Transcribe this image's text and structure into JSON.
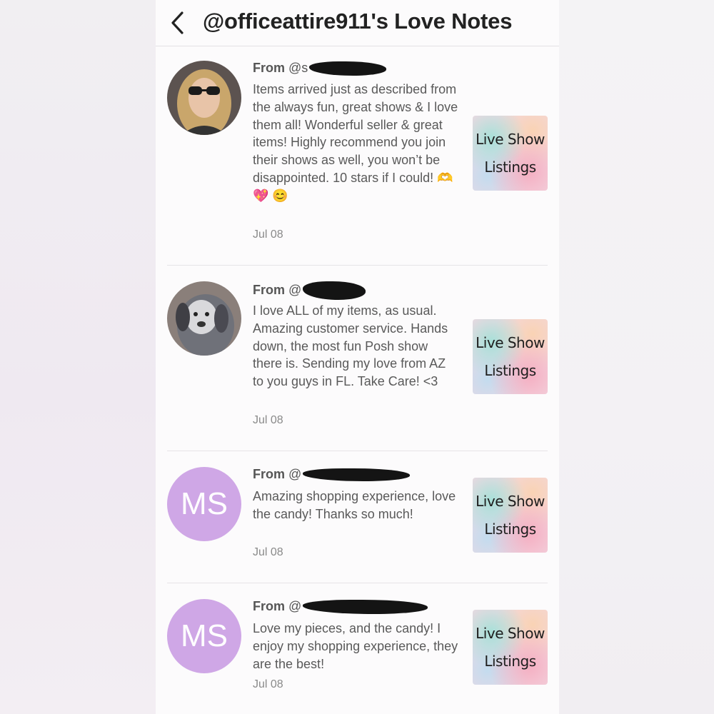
{
  "header": {
    "title": "@officeattire911's Love Notes"
  },
  "notes": [
    {
      "from_label": "From",
      "from_handle_visible": "@s",
      "body": "Items arrived just as described from the always fun, great shows & I love them all! Wonderful seller & great items! Highly recommend you join their shows as well, you won’t be disappointed. 10 stars if I could! 🫶 💖 😊",
      "date": "Jul 08",
      "avatar": "photo-woman-sunglasses",
      "listing_thumb": {
        "line1": "Live Show",
        "line2": "Listings"
      }
    },
    {
      "from_label": "From",
      "from_handle_visible": "@",
      "body": "I love ALL of my items, as usual. Amazing customer service. Hands down, the most fun Posh show there is. Sending my love from AZ to you guys in FL. Take Care! <3",
      "date": "Jul 08",
      "avatar": "photo-dog",
      "listing_thumb": {
        "line1": "Live Show",
        "line2": "Listings"
      }
    },
    {
      "from_label": "From",
      "from_handle_visible": "@",
      "body": "Amazing shopping experience, love the candy! Thanks so much!",
      "date": "Jul 08",
      "avatar_initials": "MS",
      "listing_thumb": {
        "line1": "Live Show",
        "line2": "Listings"
      }
    },
    {
      "from_label": "From",
      "from_handle_visible": "@",
      "body": "Love my pieces, and the candy! I enjoy my shopping experience, they are the best!",
      "date": "Jul 08",
      "avatar_initials": "MS",
      "listing_thumb": {
        "line1": "Live Show",
        "line2": "Listings"
      }
    }
  ],
  "colors": {
    "initials_avatar": "#cfa7e6",
    "text_primary": "#222222",
    "text_body": "#595959"
  }
}
